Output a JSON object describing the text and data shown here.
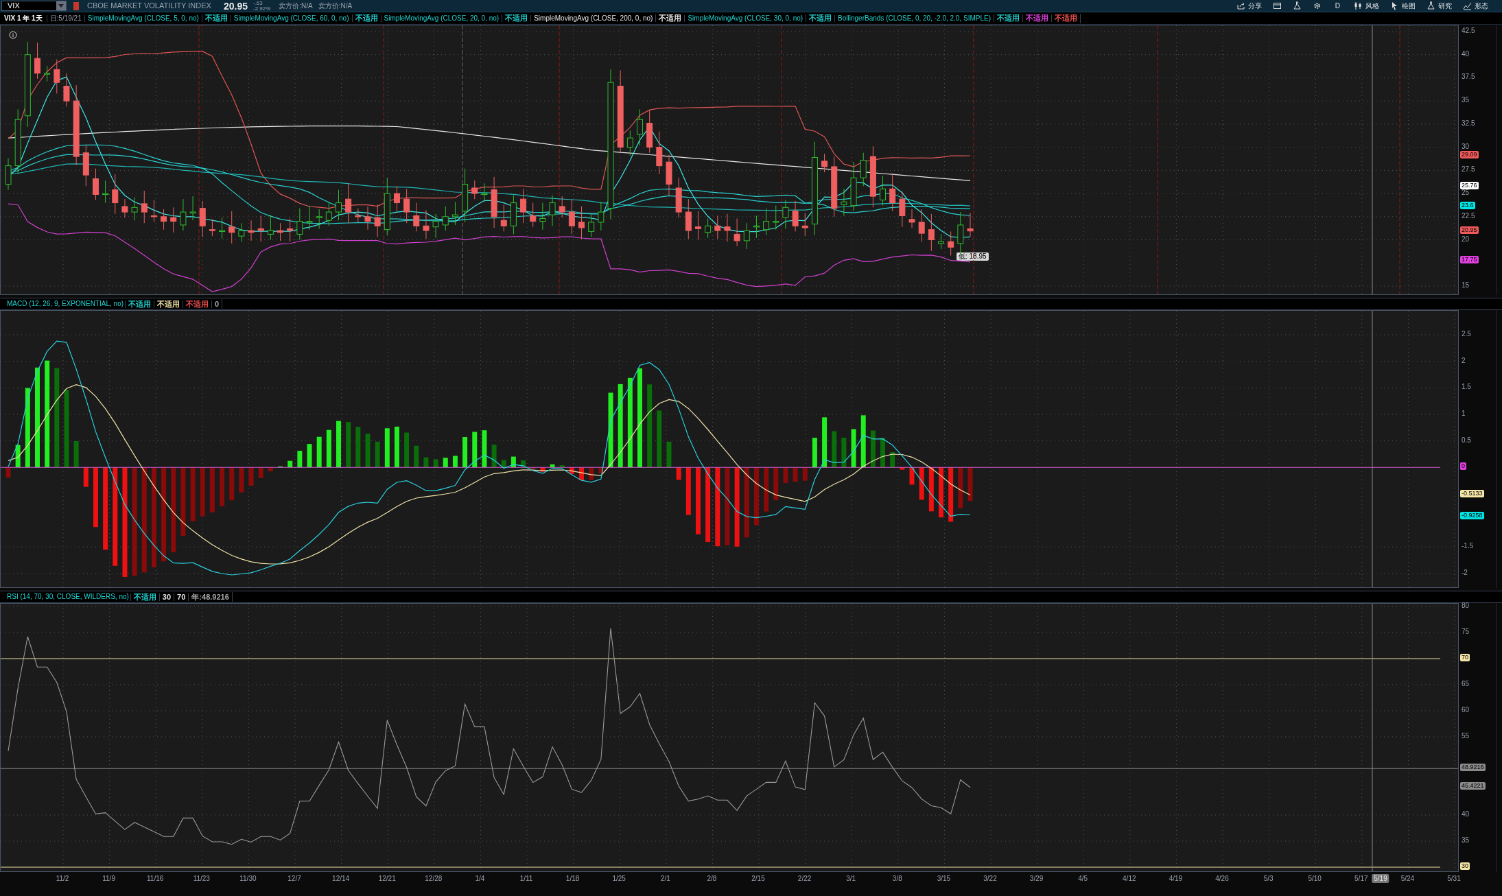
{
  "toolbar": {
    "symbol": "VIX",
    "description": "CBOE MARKET VOLATILITY INDEX",
    "last": "20.95",
    "change": "-.63",
    "change_percent": "-2.92%",
    "quotes": [
      "卖方价:N/A",
      "卖方价:N/A"
    ],
    "actions": [
      {
        "kind": "labeled",
        "label": "分享"
      },
      {
        "kind": "icon"
      },
      {
        "kind": "icon"
      },
      {
        "kind": "icon"
      },
      {
        "kind": "text",
        "label": "D"
      },
      {
        "kind": "labeled",
        "label": "风格"
      },
      {
        "kind": "labeled",
        "label": "绘图"
      },
      {
        "kind": "labeled",
        "label": "研究"
      },
      {
        "kind": "labeled",
        "label": "形态"
      }
    ]
  },
  "price_header": {
    "title": "VIX 1 年 1天",
    "date": "日:5/19/21",
    "studies": [
      {
        "label": "SimpleMovingAvg (CLOSE, 5, 0, no)",
        "color": "#22d3d3",
        "tags": [
          {
            "text": "不适用",
            "color": "#22d3d3"
          }
        ]
      },
      {
        "label": "SimpleMovingAvg (CLOSE, 60, 0, no)",
        "color": "#22d3d3",
        "tags": [
          {
            "text": "不适用",
            "color": "#22d3d3"
          }
        ]
      },
      {
        "label": "SimpleMovingAvg (CLOSE, 20, 0, no)",
        "color": "#22d3d3",
        "tags": [
          {
            "text": "不适用",
            "color": "#22d3d3"
          }
        ]
      },
      {
        "label": "SimpleMovingAvg (CLOSE, 200, 0, no)",
        "color": "#e5e5e5",
        "tags": [
          {
            "text": "不适用",
            "color": "#e5e5e5"
          }
        ]
      },
      {
        "label": "SimpleMovingAvg (CLOSE, 30, 0, no)",
        "color": "#22d3d3",
        "tags": [
          {
            "text": "不适用",
            "color": "#22d3d3"
          }
        ]
      },
      {
        "label": "BollingerBands (CLOSE, 0, 20, -2.0, 2.0, SIMPLE)",
        "color": "#22d3d3",
        "tags": [
          {
            "text": "不适用",
            "color": "#22d3d3"
          },
          {
            "text": "不适用",
            "color": "#e040e0"
          },
          {
            "text": "不适用",
            "color": "#f05050"
          }
        ]
      }
    ]
  },
  "price_panel": {
    "y_ticks": [
      "42.5",
      "40",
      "37.5",
      "35",
      "32.5",
      "30",
      "27.5",
      "25",
      "22.5",
      "20",
      "15"
    ],
    "badges": [
      {
        "text": "29.09",
        "color": "#f05a5a"
      },
      {
        "text": "25.76",
        "color": "#ffffff"
      },
      {
        "text": "23.6",
        "color": "#00e5e5"
      },
      {
        "text": "20.95",
        "color": "#f05a5a"
      },
      {
        "text": "17.75",
        "color": "#e040e0"
      }
    ],
    "low_marker": "低: 18.95"
  },
  "macd_header": {
    "label": "MACD (12, 26, 9, EXPONENTIAL, no)",
    "color": "#22d3d3",
    "tags": [
      {
        "text": "不适用",
        "color": "#22d3d3"
      },
      {
        "text": "不适用",
        "color": "#f5e6a8"
      },
      {
        "text": "不适用",
        "color": "#f05050"
      },
      {
        "text": "0",
        "color": "#aaaaaa"
      }
    ]
  },
  "macd_panel": {
    "y_ticks": [
      "2.5",
      "2",
      "1.5",
      "1",
      "0.5",
      "-1.5",
      "-2"
    ],
    "badges": [
      {
        "text": "0",
        "color": "#e040e0"
      },
      {
        "text": "-0.5133",
        "color": "#f5e6a8"
      },
      {
        "text": "-0.9258",
        "color": "#00e5e5"
      }
    ]
  },
  "rsi_header": {
    "label": "RSI (14, 70, 30, CLOSE, WILDERS, no)",
    "color": "#22d3d3",
    "tags": [
      {
        "text": "不适用",
        "color": "#22d3d3"
      },
      {
        "text": "30",
        "color": "#e5e5e5"
      },
      {
        "text": "70",
        "color": "#e5e5e5"
      },
      {
        "text": "年:48.9216",
        "color": "#aaaaaa"
      }
    ]
  },
  "rsi_panel": {
    "y_ticks": [
      "80",
      "75",
      "65",
      "60",
      "55",
      "40",
      "35"
    ],
    "badges": [
      {
        "text": "70",
        "color": "#f5e6a8"
      },
      {
        "text": "48.9216",
        "color": "#8a8a8a"
      },
      {
        "text": "45.4221",
        "color": "#8a8a8a"
      },
      {
        "text": "30",
        "color": "#f5e6a8"
      }
    ]
  },
  "date_axis": {
    "labels": [
      "11/2",
      "11/9",
      "11/16",
      "11/23",
      "11/30",
      "12/7",
      "12/14",
      "12/21",
      "12/28",
      "1/4",
      "1/11",
      "1/18",
      "1/25",
      "2/1",
      "2/8",
      "2/15",
      "2/22",
      "3/1",
      "3/8",
      "3/15",
      "3/22",
      "3/29",
      "4/5",
      "4/12",
      "4/19",
      "4/26",
      "5/3",
      "5/10",
      "5/17",
      "5/24",
      "5/31"
    ],
    "cursor_date": "5/19"
  }
}
